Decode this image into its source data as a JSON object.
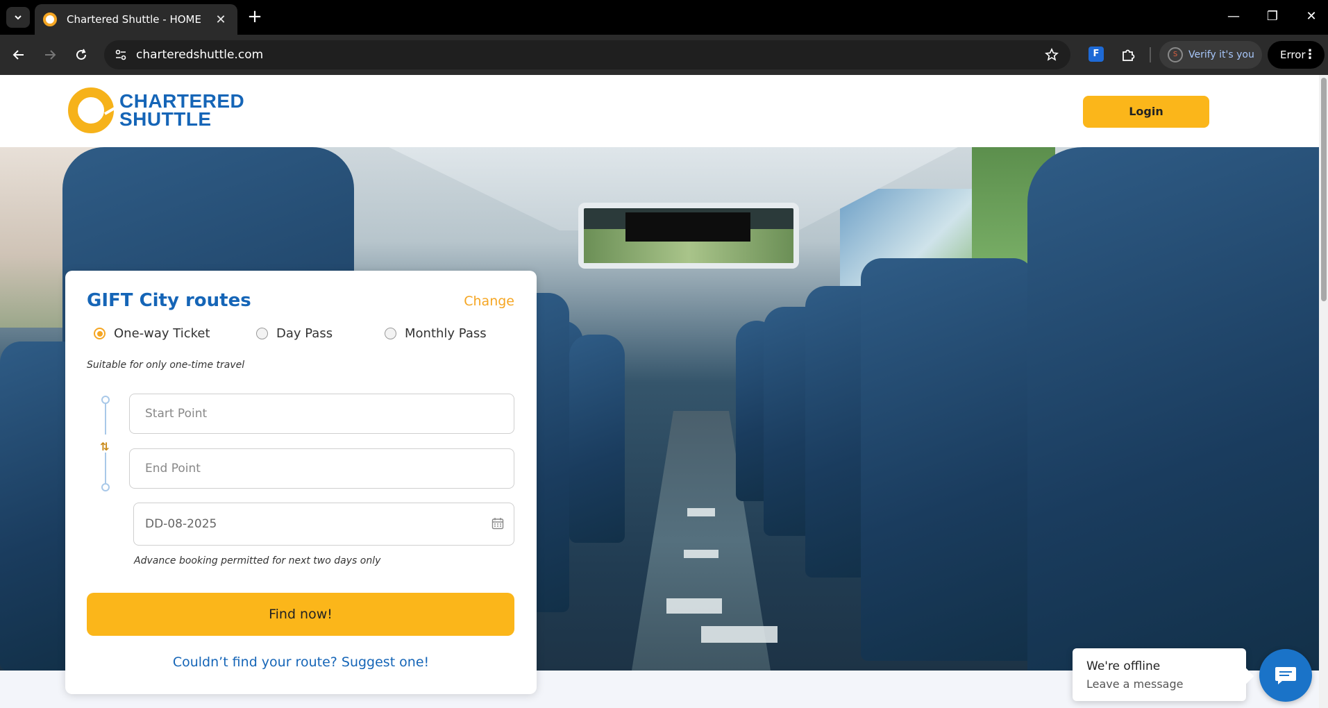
{
  "browser": {
    "tab_title": "Chartered Shuttle - HOME",
    "url": "charteredshuttle.com",
    "profile_label": "Verify it's you",
    "profile_initial": "S",
    "error_label": "Error",
    "extension_label": "F"
  },
  "header": {
    "logo_line1": "CHARTERED",
    "logo_line2": "SHUTTLE",
    "login_label": "Login"
  },
  "booking": {
    "title": "GIFT City routes",
    "change_label": "Change",
    "ticket_types": [
      {
        "label": "One-way Ticket",
        "selected": true
      },
      {
        "label": "Day Pass",
        "selected": false
      },
      {
        "label": "Monthly Pass",
        "selected": false
      }
    ],
    "ticket_hint": "Suitable for only one-time travel",
    "start_placeholder": "Start Point",
    "end_placeholder": "End Point",
    "date_value": "DD-08-2025",
    "date_hint": "Advance booking permitted for next two days only",
    "find_label": "Find now!",
    "suggest_label": "Couldn’t find your route? Suggest one!"
  },
  "chat": {
    "title": "We're offline",
    "subtitle": "Leave a message"
  },
  "colors": {
    "brand_blue": "#1565b7",
    "brand_yellow": "#fbb61a",
    "chat_blue": "#1a73c8"
  }
}
